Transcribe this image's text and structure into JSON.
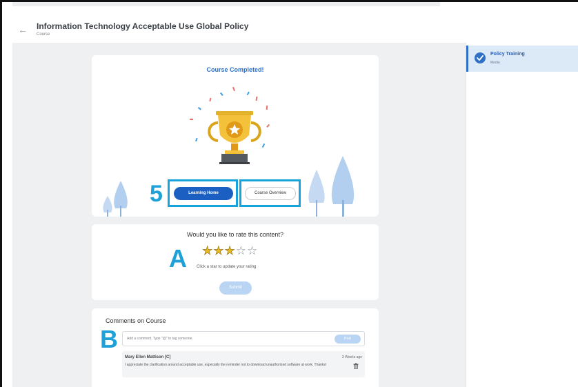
{
  "header": {
    "title": "Information Technology Acceptable Use Global Policy",
    "subtitle": "Course",
    "back_icon": "arrow-left-icon"
  },
  "sidebar": {
    "items": [
      {
        "title": "Policy Training",
        "subtitle": "Media",
        "status_icon": "check-circle-icon",
        "status": "completed"
      }
    ]
  },
  "completion": {
    "title": "Course Completed!",
    "illustration": "trophy-icon",
    "primary_button": "Learning Home",
    "secondary_button": "Course Overview",
    "annotation": "5"
  },
  "rating": {
    "title": "Would you like to rate this content?",
    "annotation": "A",
    "max_stars": 5,
    "current_rating": 3,
    "hint": "Click a star to update your rating",
    "submit_label": "Submit"
  },
  "comments": {
    "title": "Comments on Course",
    "annotation": "B",
    "input_placeholder": "Add a comment. Type \"@\" to tag someone.",
    "post_label": "Post",
    "items": [
      {
        "author": "Mary Ellen Mattison [C]",
        "time": "3 Weeks ago",
        "body": "I appreciate the clarification around acceptable use, especially the reminder not to download unauthorized software at work. Thanks!"
      }
    ]
  },
  "colors": {
    "accent": "#1b5fc2",
    "annotation": "#1ea0d8",
    "star_filled": "#e8b923",
    "background": "#eef0f2"
  }
}
